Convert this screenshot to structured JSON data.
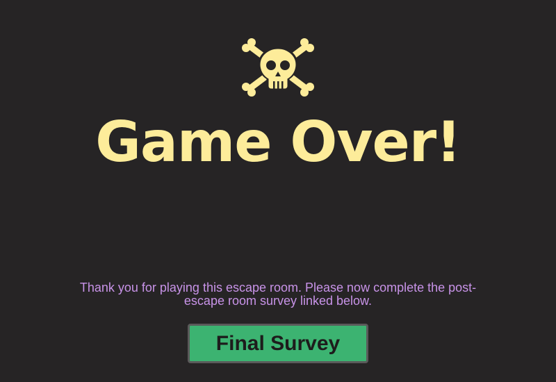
{
  "screen": {
    "icon": "skull-and-crossbones-icon",
    "title": "Game Over!",
    "message": "Thank you for playing this escape room. Please now complete the post-escape room survey linked below.",
    "button_label": "Final Survey"
  },
  "colors": {
    "background": "#262425",
    "title": "#fdec9a",
    "icon": "#fdec9a",
    "message": "#c893e8",
    "button_bg": "#3cb371",
    "button_border": "#5a5a5a",
    "button_text": "#1d1c1c"
  }
}
